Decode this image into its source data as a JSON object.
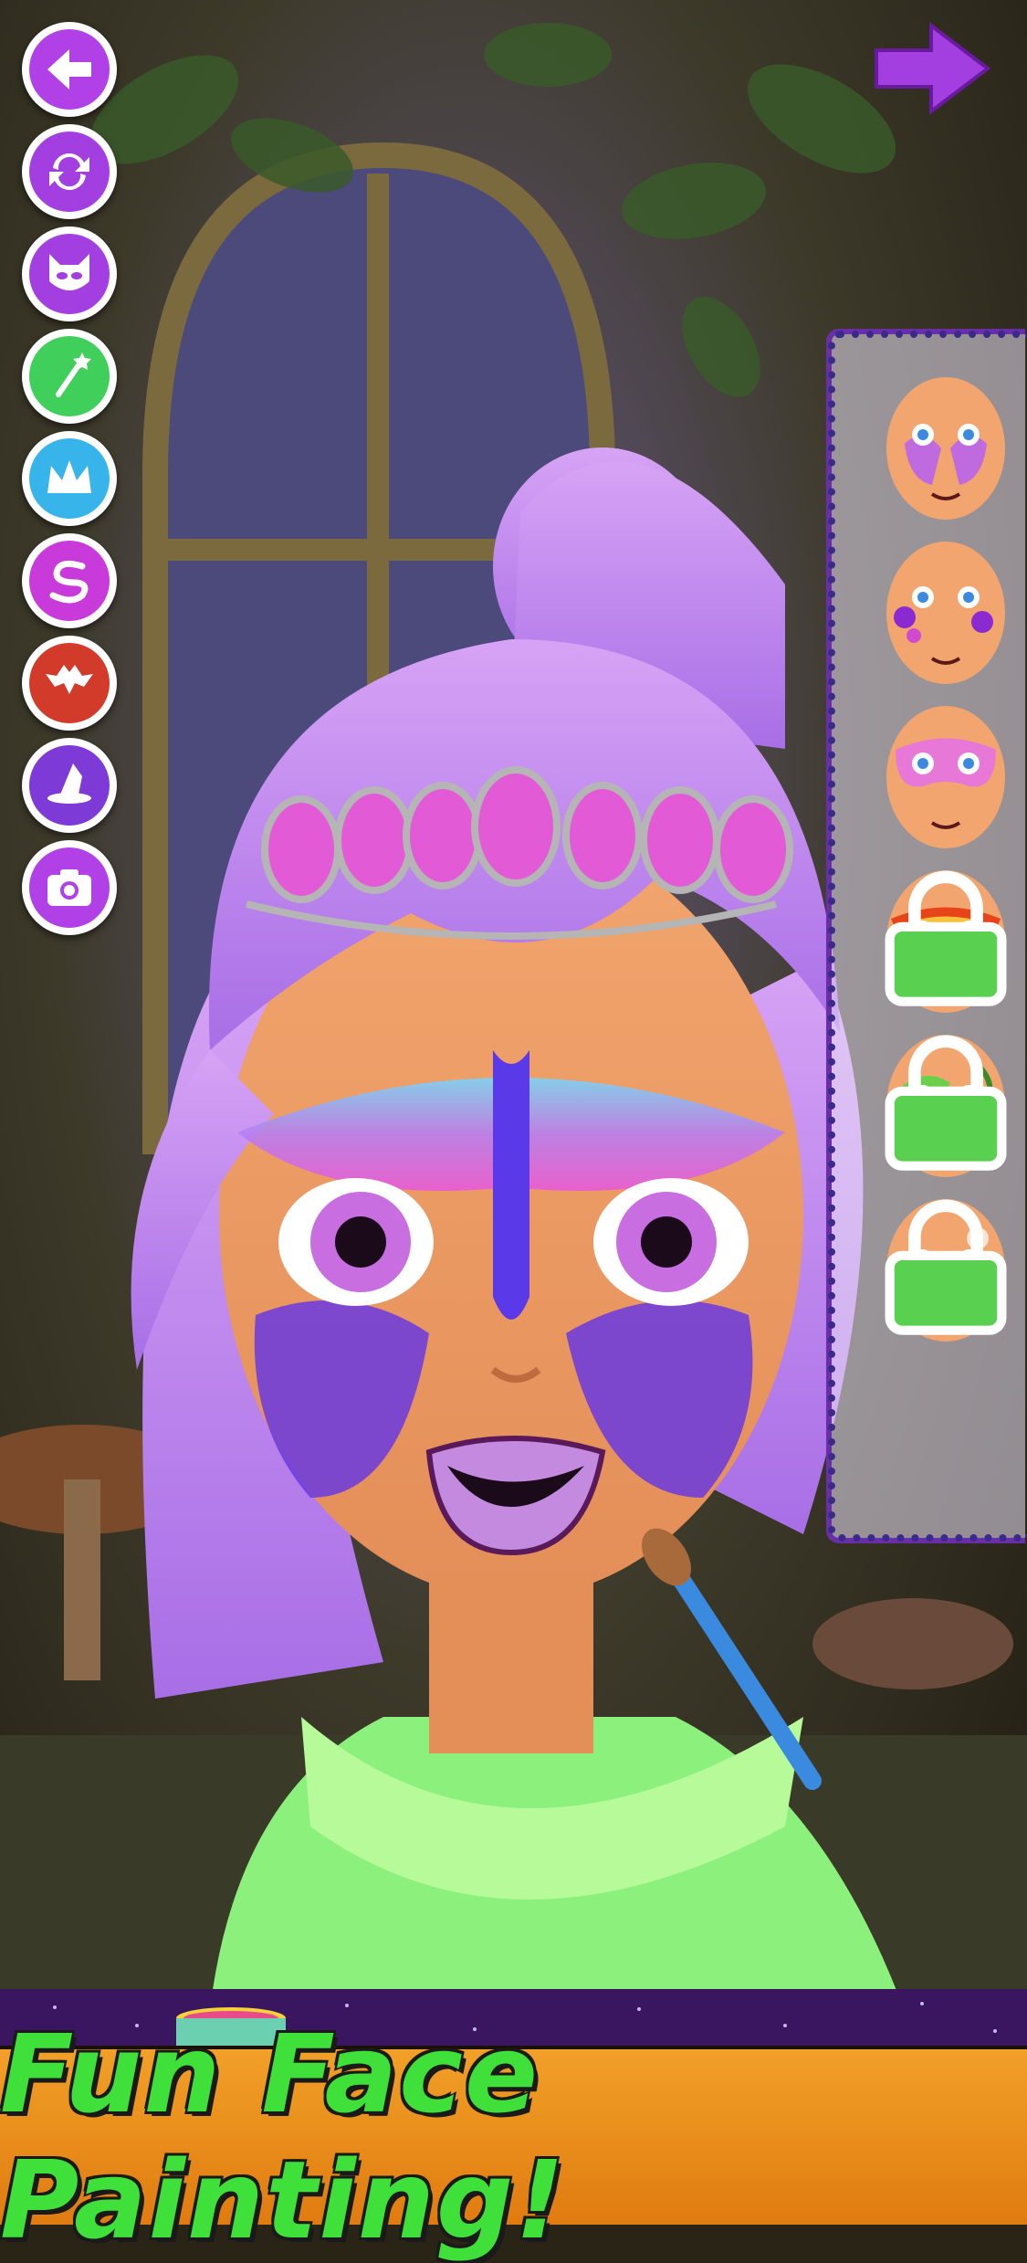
{
  "banner": {
    "text": "Fun Face Painting!"
  },
  "colors": {
    "purple": "#a33ee0",
    "green": "#3fe03a",
    "orange": "#f1a028",
    "panel_border": "#6a2fa8"
  },
  "toolbar": [
    {
      "name": "back-icon",
      "color": "#b140e6"
    },
    {
      "name": "reset-icon",
      "color": "#a33ee0"
    },
    {
      "name": "mask-icon",
      "color": "#a33ee0"
    },
    {
      "name": "magic-wand-icon",
      "color": "#3fcf5a"
    },
    {
      "name": "crown-icon",
      "color": "#37b5ea"
    },
    {
      "name": "swirl-icon",
      "color": "#c83ad9"
    },
    {
      "name": "bat-icon",
      "color": "#d23a2a"
    },
    {
      "name": "witch-hat-icon",
      "color": "#7d3ad6"
    },
    {
      "name": "camera-icon",
      "color": "#b140e6"
    }
  ],
  "designs": [
    {
      "name": "butterfly-face-design",
      "locked": false
    },
    {
      "name": "flower-face-design",
      "locked": false
    },
    {
      "name": "pink-mask-design",
      "locked": false
    },
    {
      "name": "fire-face-design",
      "locked": true
    },
    {
      "name": "green-swirl-design",
      "locked": true
    },
    {
      "name": "white-flower-design",
      "locked": true
    }
  ]
}
